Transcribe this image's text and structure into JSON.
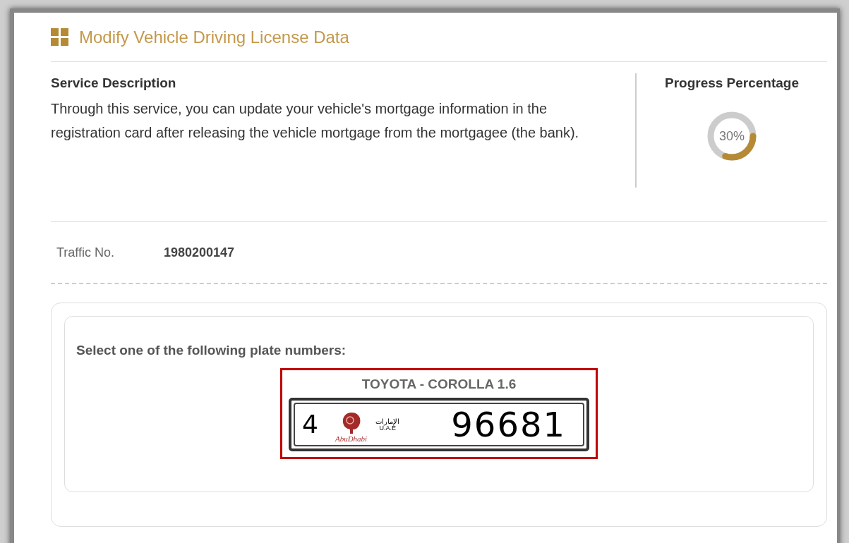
{
  "page_title": "Modify Vehicle Driving License Data",
  "service": {
    "heading": "Service Description",
    "text": "Through this service, you can update your vehicle's mortgage information in the registration card after releasing the vehicle mortgage from the mortgagee (the bank)."
  },
  "progress": {
    "heading": "Progress Percentage",
    "reading": "30%"
  },
  "traffic": {
    "label": "Traffic No.",
    "value": "1980200147"
  },
  "plates_prompt": "Select one of the following plate numbers:",
  "plates": [
    {
      "vehicle": "TOYOTA - COROLLA 1.6",
      "selected": true,
      "code": "4",
      "emirate": "AbuDhabi",
      "country_ar": "الإمارات",
      "country": "U.A.E",
      "number": "96681"
    }
  ]
}
